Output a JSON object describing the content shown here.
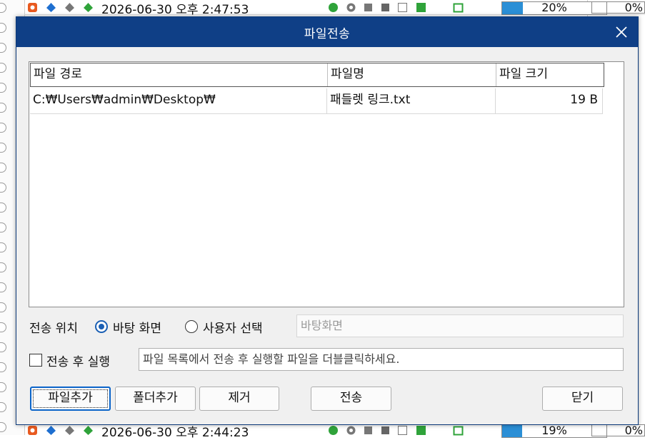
{
  "background": {
    "top_row": {
      "timestamp": "2026-06-30 오후 2:47:53",
      "progress_percent": 20,
      "progress_label": "20%",
      "last_value": "0%"
    },
    "bottom_row": {
      "timestamp": "2026-06-30 오후 2:44:23",
      "progress_percent": 19,
      "progress_label": "19%",
      "last_value": "0%"
    },
    "colors": {
      "progress_fill": "#2b8fd6",
      "status_green": "#2fa33a",
      "icon_orange": "#e85a20",
      "icon_blue": "#1e6fd0"
    }
  },
  "dialog": {
    "title": "파일전송",
    "colors": {
      "titlebar": "#0f3f86",
      "default_button_border": "#0a64c9"
    },
    "table": {
      "columns": [
        "파일 경로",
        "파일명",
        "파일 크기"
      ],
      "rows": [
        {
          "path": "C:₩Users₩admin₩Desktop₩",
          "name": "패들렛 링크.txt",
          "size": "19  B"
        }
      ]
    },
    "destination": {
      "label": "전송 위치",
      "option_desktop": "바탕 화면",
      "option_user": "사용자 선택",
      "selected": "desktop",
      "path_value": "바탕화면"
    },
    "run_after": {
      "label": "전송 후 실행",
      "checked": false,
      "hint": "파일 목록에서 전송 후 실행할 파일을 더블클릭하세요."
    },
    "buttons": {
      "add_file": "파일추가",
      "add_folder": "폴더추가",
      "remove": "제거",
      "send": "전송",
      "close": "닫기"
    }
  }
}
